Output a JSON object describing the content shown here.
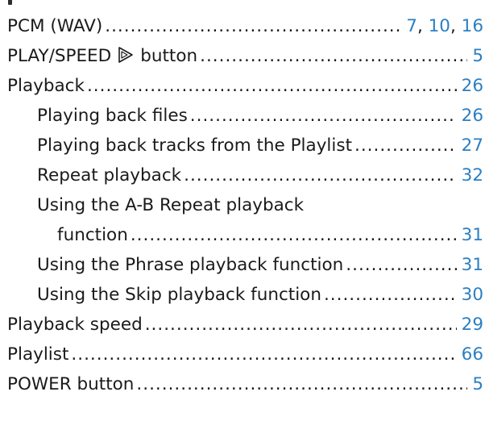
{
  "entries": [
    {
      "term": "PCM (WAV)",
      "pages": [
        "7",
        "10",
        "16"
      ]
    },
    {
      "term_before": "PLAY/SPEED",
      "icon": "play-outline-icon",
      "term_after": "button",
      "pages": [
        "5"
      ]
    },
    {
      "term": "Playback",
      "pages": [
        "26"
      ]
    },
    {
      "term": "Playing back files",
      "pages": [
        "26"
      ]
    },
    {
      "term": "Playing back tracks from the Playlist",
      "pages": [
        "27"
      ]
    },
    {
      "term": "Repeat playback",
      "pages": [
        "32"
      ]
    },
    {
      "term_line1": "Using the A-B Repeat playback",
      "term_line2": "function",
      "pages": [
        "31"
      ]
    },
    {
      "term": "Using the Phrase playback function",
      "pages": [
        "31"
      ]
    },
    {
      "term": "Using the Skip playback function",
      "pages": [
        "30"
      ]
    },
    {
      "term": "Playback speed",
      "pages": [
        "29"
      ]
    },
    {
      "term": "Playlist",
      "pages": [
        "66"
      ]
    },
    {
      "term": "POWER button",
      "pages": [
        "5"
      ]
    }
  ],
  "colors": {
    "text": "#1a1a1a",
    "page_link": "#2b7fc3"
  }
}
